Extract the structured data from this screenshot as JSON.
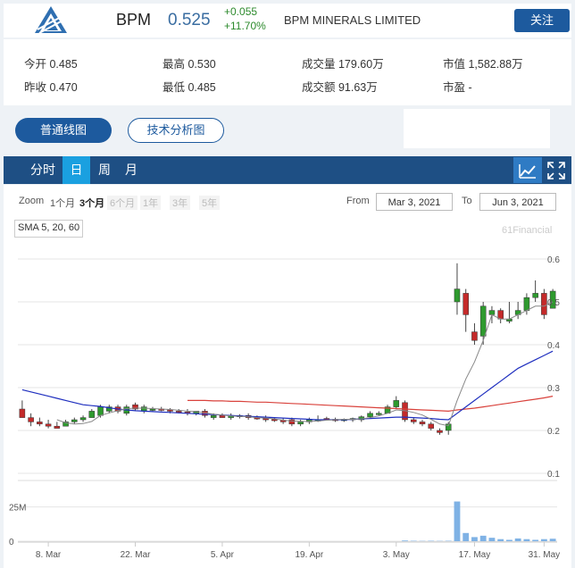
{
  "header": {
    "ticker": "BPM",
    "price": "0.525",
    "change": "+0.055",
    "change_pct": "+11.70%",
    "company": "BPM MINERALS LIMITED",
    "follow_label": "关注",
    "logo": "bpm-logo"
  },
  "stats": {
    "open": "今开 0.485",
    "high": "最高 0.530",
    "volume": "成交量 179.60万",
    "mktcap": "市值 1,582.88万",
    "prev_close": "昨收 0.470",
    "low": "最低 0.485",
    "turnover": "成交额 91.63万",
    "pe": "市盈 -"
  },
  "chart_types": [
    "普通线图",
    "技术分析图"
  ],
  "period_tabs": [
    "分时",
    "日",
    "周",
    "月"
  ],
  "active_period": "日",
  "zoom": {
    "label": "Zoom",
    "options": [
      "1个月",
      "3个月",
      "6个月",
      "1年",
      "3年",
      "5年"
    ],
    "selected": "3个月",
    "from_label": "From",
    "from": "Mar 3, 2021",
    "to_label": "To",
    "to": "Jun 3, 2021"
  },
  "indicator_label": "SMA 5, 20, 60",
  "watermark": "61Financial",
  "colors": {
    "up": "#2e9a2e",
    "down": "#c42a2a",
    "sma5": "#888888",
    "sma20": "#1f2fbf",
    "sma60": "#d9423c",
    "volume": "#7fb2e5",
    "accent": "#1d5a9e"
  },
  "chart_data": {
    "type": "candlestick",
    "y_ticks": [
      "0.6",
      "0.5",
      "0.4",
      "0.3",
      "0.2",
      "0.1"
    ],
    "ylim": [
      0.1,
      0.6
    ],
    "volume_ticks": [
      "25M",
      "0"
    ],
    "x_ticks": [
      "8. Mar",
      "22. Mar",
      "5. Apr",
      "19. Apr",
      "3. May",
      "17. May",
      "31. May"
    ],
    "candles": [
      {
        "o": 0.25,
        "h": 0.27,
        "l": 0.23,
        "c": 0.23
      },
      {
        "o": 0.23,
        "h": 0.24,
        "l": 0.21,
        "c": 0.22
      },
      {
        "o": 0.22,
        "h": 0.23,
        "l": 0.21,
        "c": 0.215
      },
      {
        "o": 0.215,
        "h": 0.225,
        "l": 0.205,
        "c": 0.21
      },
      {
        "o": 0.21,
        "h": 0.22,
        "l": 0.205,
        "c": 0.205
      },
      {
        "o": 0.21,
        "h": 0.225,
        "l": 0.21,
        "c": 0.22
      },
      {
        "o": 0.22,
        "h": 0.23,
        "l": 0.215,
        "c": 0.225
      },
      {
        "o": 0.225,
        "h": 0.235,
        "l": 0.22,
        "c": 0.23
      },
      {
        "o": 0.23,
        "h": 0.25,
        "l": 0.23,
        "c": 0.245
      },
      {
        "o": 0.235,
        "h": 0.26,
        "l": 0.23,
        "c": 0.255
      },
      {
        "o": 0.245,
        "h": 0.26,
        "l": 0.24,
        "c": 0.255
      },
      {
        "o": 0.255,
        "h": 0.26,
        "l": 0.24,
        "c": 0.245
      },
      {
        "o": 0.24,
        "h": 0.26,
        "l": 0.235,
        "c": 0.255
      },
      {
        "o": 0.26,
        "h": 0.265,
        "l": 0.245,
        "c": 0.25
      },
      {
        "o": 0.245,
        "h": 0.26,
        "l": 0.24,
        "c": 0.255
      },
      {
        "o": 0.25,
        "h": 0.255,
        "l": 0.245,
        "c": 0.25
      },
      {
        "o": 0.25,
        "h": 0.255,
        "l": 0.245,
        "c": 0.248
      },
      {
        "o": 0.248,
        "h": 0.252,
        "l": 0.24,
        "c": 0.245
      },
      {
        "o": 0.245,
        "h": 0.25,
        "l": 0.24,
        "c": 0.243
      },
      {
        "o": 0.243,
        "h": 0.25,
        "l": 0.235,
        "c": 0.24
      },
      {
        "o": 0.24,
        "h": 0.245,
        "l": 0.235,
        "c": 0.245
      },
      {
        "o": 0.245,
        "h": 0.25,
        "l": 0.23,
        "c": 0.235
      },
      {
        "o": 0.23,
        "h": 0.24,
        "l": 0.225,
        "c": 0.235
      },
      {
        "o": 0.235,
        "h": 0.24,
        "l": 0.23,
        "c": 0.23
      },
      {
        "o": 0.23,
        "h": 0.24,
        "l": 0.225,
        "c": 0.235
      },
      {
        "o": 0.232,
        "h": 0.238,
        "l": 0.228,
        "c": 0.235
      },
      {
        "o": 0.235,
        "h": 0.24,
        "l": 0.225,
        "c": 0.23
      },
      {
        "o": 0.23,
        "h": 0.235,
        "l": 0.225,
        "c": 0.228
      },
      {
        "o": 0.228,
        "h": 0.235,
        "l": 0.22,
        "c": 0.226
      },
      {
        "o": 0.226,
        "h": 0.23,
        "l": 0.22,
        "c": 0.224
      },
      {
        "o": 0.224,
        "h": 0.23,
        "l": 0.215,
        "c": 0.22
      },
      {
        "o": 0.225,
        "h": 0.23,
        "l": 0.21,
        "c": 0.215
      },
      {
        "o": 0.215,
        "h": 0.225,
        "l": 0.21,
        "c": 0.22
      },
      {
        "o": 0.22,
        "h": 0.23,
        "l": 0.215,
        "c": 0.225
      },
      {
        "o": 0.225,
        "h": 0.235,
        "l": 0.22,
        "c": 0.225
      },
      {
        "o": 0.228,
        "h": 0.232,
        "l": 0.224,
        "c": 0.226
      },
      {
        "o": 0.226,
        "h": 0.23,
        "l": 0.22,
        "c": 0.225
      },
      {
        "o": 0.224,
        "h": 0.228,
        "l": 0.22,
        "c": 0.226
      },
      {
        "o": 0.226,
        "h": 0.23,
        "l": 0.22,
        "c": 0.228
      },
      {
        "o": 0.225,
        "h": 0.235,
        "l": 0.22,
        "c": 0.232
      },
      {
        "o": 0.232,
        "h": 0.245,
        "l": 0.23,
        "c": 0.24
      },
      {
        "o": 0.238,
        "h": 0.245,
        "l": 0.235,
        "c": 0.24
      },
      {
        "o": 0.24,
        "h": 0.26,
        "l": 0.24,
        "c": 0.255
      },
      {
        "o": 0.255,
        "h": 0.28,
        "l": 0.25,
        "c": 0.27
      },
      {
        "o": 0.265,
        "h": 0.27,
        "l": 0.22,
        "c": 0.225
      },
      {
        "o": 0.225,
        "h": 0.23,
        "l": 0.215,
        "c": 0.22
      },
      {
        "o": 0.22,
        "h": 0.225,
        "l": 0.21,
        "c": 0.215
      },
      {
        "o": 0.215,
        "h": 0.22,
        "l": 0.2,
        "c": 0.205
      },
      {
        "o": 0.2,
        "h": 0.205,
        "l": 0.19,
        "c": 0.195
      },
      {
        "o": 0.2,
        "h": 0.22,
        "l": 0.19,
        "c": 0.215
      },
      {
        "o": 0.5,
        "h": 0.59,
        "l": 0.47,
        "c": 0.53
      },
      {
        "o": 0.52,
        "h": 0.53,
        "l": 0.43,
        "c": 0.47
      },
      {
        "o": 0.43,
        "h": 0.45,
        "l": 0.4,
        "c": 0.41
      },
      {
        "o": 0.42,
        "h": 0.5,
        "l": 0.4,
        "c": 0.49
      },
      {
        "o": 0.47,
        "h": 0.49,
        "l": 0.45,
        "c": 0.48
      },
      {
        "o": 0.48,
        "h": 0.485,
        "l": 0.45,
        "c": 0.46
      },
      {
        "o": 0.455,
        "h": 0.5,
        "l": 0.45,
        "c": 0.46
      },
      {
        "o": 0.47,
        "h": 0.5,
        "l": 0.46,
        "c": 0.48
      },
      {
        "o": 0.48,
        "h": 0.52,
        "l": 0.47,
        "c": 0.51
      },
      {
        "o": 0.51,
        "h": 0.55,
        "l": 0.5,
        "c": 0.52
      },
      {
        "o": 0.52,
        "h": 0.53,
        "l": 0.46,
        "c": 0.47
      },
      {
        "o": 0.485,
        "h": 0.53,
        "l": 0.485,
        "c": 0.525
      }
    ],
    "sma5": [
      null,
      null,
      null,
      null,
      0.225,
      0.218,
      0.215,
      0.216,
      0.221,
      0.235,
      0.241,
      0.246,
      0.251,
      0.252,
      0.252,
      0.251,
      0.25,
      0.249,
      0.247,
      0.245,
      0.244,
      0.241,
      0.238,
      0.236,
      0.234,
      0.233,
      0.232,
      0.23,
      0.229,
      0.227,
      0.224,
      0.222,
      0.221,
      0.221,
      0.222,
      0.224,
      0.225,
      0.226,
      0.226,
      0.227,
      0.23,
      0.234,
      0.24,
      0.248,
      0.246,
      0.242,
      0.236,
      0.226,
      0.215,
      0.211,
      0.27,
      0.32,
      0.36,
      0.41,
      0.47,
      0.46,
      0.46,
      0.47,
      0.48,
      0.49,
      0.49,
      0.5
    ],
    "sma20": [
      0.295,
      0.29,
      0.285,
      0.28,
      0.275,
      0.27,
      0.265,
      0.26,
      0.258,
      0.256,
      0.253,
      0.25,
      0.248,
      0.246,
      0.245,
      0.244,
      0.243,
      0.242,
      0.241,
      0.24,
      0.239,
      0.238,
      0.237,
      0.236,
      0.235,
      0.234,
      0.233,
      0.232,
      0.231,
      0.23,
      0.229,
      0.228,
      0.227,
      0.226,
      0.225,
      0.225,
      0.225,
      0.225,
      0.226,
      0.227,
      0.228,
      0.229,
      0.23,
      0.231,
      0.231,
      0.23,
      0.229,
      0.228,
      0.226,
      0.225,
      0.24,
      0.255,
      0.27,
      0.285,
      0.3,
      0.315,
      0.33,
      0.345,
      0.355,
      0.365,
      0.375,
      0.385
    ],
    "sma60": [
      null,
      null,
      null,
      null,
      null,
      null,
      null,
      null,
      null,
      null,
      null,
      null,
      null,
      null,
      null,
      null,
      null,
      null,
      null,
      0.27,
      0.27,
      0.27,
      0.269,
      0.269,
      0.268,
      0.268,
      0.267,
      0.266,
      0.266,
      0.265,
      0.264,
      0.263,
      0.262,
      0.261,
      0.26,
      0.259,
      0.258,
      0.257,
      0.256,
      0.255,
      0.254,
      0.253,
      0.252,
      0.251,
      0.25,
      0.249,
      0.248,
      0.247,
      0.246,
      0.245,
      0.248,
      0.25,
      0.252,
      0.255,
      0.258,
      0.261,
      0.264,
      0.267,
      0.27,
      0.273,
      0.276,
      0.28
    ],
    "volume_m": [
      0,
      0,
      0,
      0,
      0,
      0,
      0,
      0,
      0,
      0,
      0,
      0,
      0,
      0,
      0,
      0,
      0,
      0,
      0,
      0,
      0,
      0,
      0,
      0,
      0,
      0,
      0,
      0,
      0,
      0,
      0,
      0,
      0,
      0,
      0,
      0,
      0,
      0,
      0,
      0,
      0,
      0,
      0,
      0,
      0.5,
      0.3,
      0.2,
      0.3,
      0.2,
      0.3,
      29,
      6,
      3,
      4,
      2.5,
      1.5,
      1,
      2,
      1.5,
      1,
      1.5,
      1.8
    ]
  }
}
